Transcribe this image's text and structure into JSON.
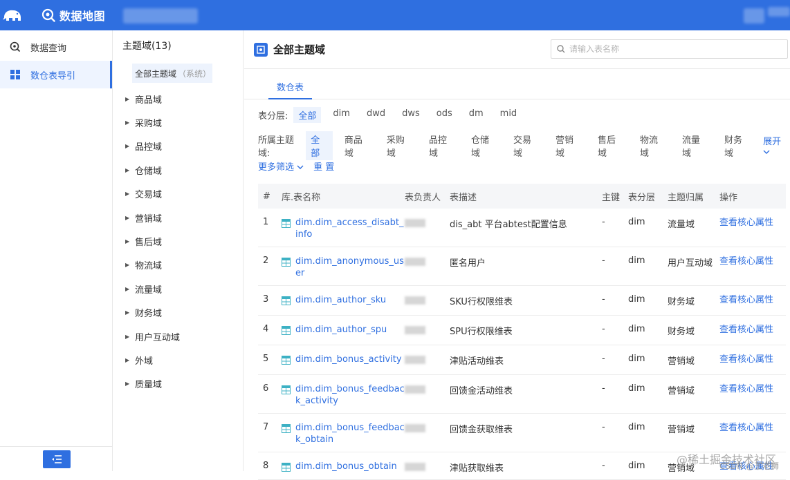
{
  "header": {
    "title": "数据地图",
    "logo_icon": "elephant-logo-icon",
    "brand_icon": "search-map-icon",
    "color": "#2f6fe0"
  },
  "leftnav": {
    "items": [
      {
        "label": "数据查询",
        "icon": "search-icon",
        "active": false
      },
      {
        "label": "数仓表导引",
        "icon": "grid-icon",
        "active": true
      }
    ]
  },
  "domains": {
    "header": "主题域(13)",
    "all_label": "全部主题域",
    "all_suffix": "（系统）",
    "items": [
      "商品域",
      "采购域",
      "品控域",
      "仓储域",
      "交易域",
      "营销域",
      "售后域",
      "物流域",
      "流量域",
      "财务域",
      "用户互动域",
      "外域",
      "质量域"
    ]
  },
  "main": {
    "title": "全部主题域",
    "search_placeholder": "请输入表名称",
    "tab": "数仓表",
    "layer_filter": {
      "label": "表分层:",
      "options": [
        "全部",
        "dim",
        "dwd",
        "dws",
        "ods",
        "dm",
        "mid"
      ]
    },
    "domain_filter": {
      "label": "所属主题域:",
      "options": [
        "全部",
        "商品域",
        "采购域",
        "品控域",
        "仓储域",
        "交易域",
        "营销域",
        "售后域",
        "物流域",
        "流量域",
        "财务域"
      ],
      "expand": "展开"
    },
    "more_filter": "更多筛选",
    "reset": "重 置"
  },
  "table": {
    "headers": [
      "#",
      "库.表名称",
      "表负责人",
      "表描述",
      "主键",
      "表分层",
      "主题归属",
      "操作"
    ],
    "rows": [
      {
        "num": "1",
        "name": "dim.dim_access_disabt_info",
        "desc": "dis_abt 平台abtest配置信息",
        "pk": "-",
        "layer": "dim",
        "domain": "流量域",
        "op": "查看核心属性"
      },
      {
        "num": "2",
        "name": "dim.dim_anonymous_user",
        "desc": "匿名用户",
        "pk": "-",
        "layer": "dim",
        "domain": "用户互动域",
        "op": "查看核心属性"
      },
      {
        "num": "3",
        "name": "dim.dim_author_sku",
        "desc": "SKU行权限维表",
        "pk": "-",
        "layer": "dim",
        "domain": "财务域",
        "op": "查看核心属性"
      },
      {
        "num": "4",
        "name": "dim.dim_author_spu",
        "desc": "SPU行权限维表",
        "pk": "-",
        "layer": "dim",
        "domain": "财务域",
        "op": "查看核心属性"
      },
      {
        "num": "5",
        "name": "dim.dim_bonus_activity",
        "desc": "津贴活动维表",
        "pk": "-",
        "layer": "dim",
        "domain": "营销域",
        "op": "查看核心属性"
      },
      {
        "num": "6",
        "name": "dim.dim_bonus_feedback_activity",
        "desc": "回馈金活动维表",
        "pk": "-",
        "layer": "dim",
        "domain": "营销域",
        "op": "查看核心属性"
      },
      {
        "num": "7",
        "name": "dim.dim_bonus_feedback_obtain",
        "desc": "回馈金获取维表",
        "pk": "-",
        "layer": "dim",
        "domain": "营销域",
        "op": "查看核心属性"
      },
      {
        "num": "8",
        "name": "dim.dim_bonus_obtain",
        "desc": "津贴获取维表",
        "pk": "-",
        "layer": "dim",
        "domain": "营销域",
        "op": "查看核心属性"
      }
    ]
  },
  "watermark": {
    "line1": "@稀土掘金技术社区",
    "line2": "CSDN @王老狮"
  }
}
